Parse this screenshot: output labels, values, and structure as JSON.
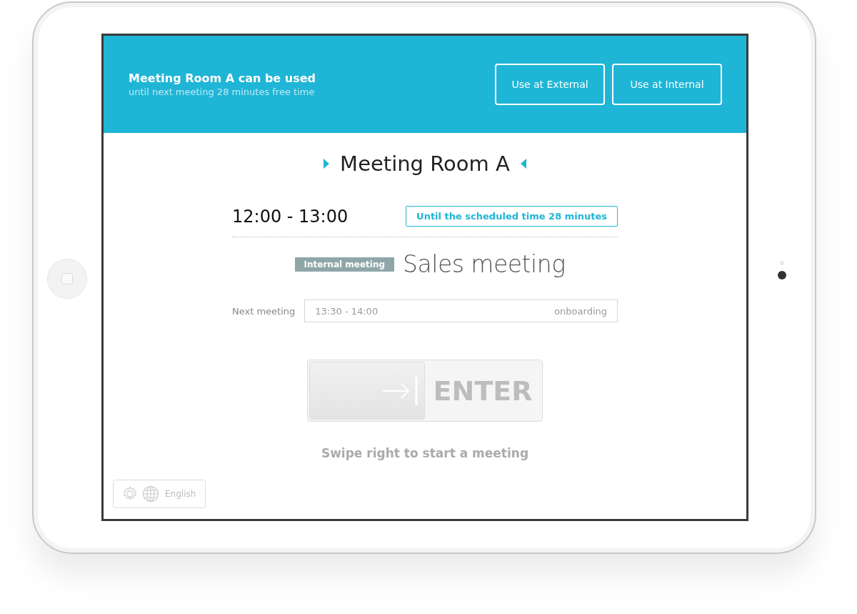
{
  "header": {
    "title": "Meeting Room A can be used",
    "subtitle": "until next meeting 28 minutes free time",
    "buttons": [
      "Use at External",
      "Use at Internal"
    ]
  },
  "room": {
    "name": "Meeting Room A"
  },
  "current_meeting": {
    "time": "12:00 - 13:00",
    "remaining": "Until the scheduled time 28 minutes",
    "tag": "Internal meeting",
    "title": "Sales meeting"
  },
  "next_meeting": {
    "label": "Next meeting",
    "time": "13:30 - 14:00",
    "name": "onboarding"
  },
  "slider": {
    "level": 0,
    "label": "ENTER",
    "hint": "Swipe right to start a meeting"
  },
  "footer": {
    "language": "English"
  }
}
